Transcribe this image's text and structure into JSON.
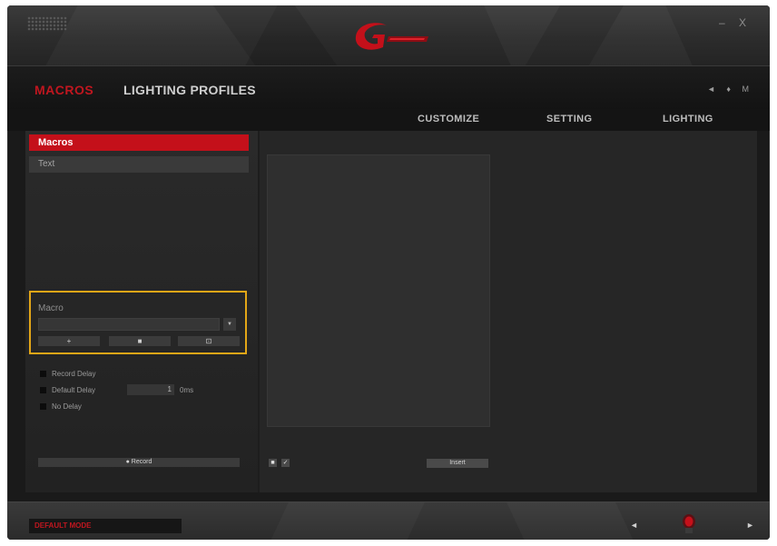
{
  "window": {
    "minimize_label": "–",
    "close_label": "X",
    "brand_color": "#c4101a"
  },
  "nav": {
    "macros_label": "MACROS",
    "lighting_profiles_label": "LIGHTING PROFILES",
    "tools": [
      "◄",
      "♦",
      "M"
    ]
  },
  "tabs": [
    {
      "label": "CUSTOMIZE"
    },
    {
      "label": "SETTING"
    },
    {
      "label": "LIGHTING"
    }
  ],
  "macro_list": {
    "items": [
      {
        "label": "Macros",
        "active": true
      },
      {
        "label": "Text",
        "active": false
      }
    ]
  },
  "macro_panel": {
    "label": "Macro",
    "selected_value": "",
    "dropdown_icon": "▼",
    "buttons": [
      {
        "label": "+",
        "icon": "plus-icon"
      },
      {
        "label": "■",
        "icon": "stop-icon"
      },
      {
        "label": "⊡",
        "icon": "copy-icon"
      }
    ]
  },
  "options": {
    "record_delay_label": "Record Delay",
    "default_delay_label": "Default Delay",
    "default_delay_value": "1",
    "delay_unit": "0ms",
    "no_delay_label": "No Delay"
  },
  "record_button_label": "● Record",
  "editor": {
    "small_buttons": [
      "■",
      "✓"
    ],
    "insert_label": "Insert"
  },
  "footer": {
    "status_text": "DEFAULT MODE",
    "prev_label": "◄",
    "next_label": "►",
    "mascot_icon": "gskill-mascot-icon"
  }
}
